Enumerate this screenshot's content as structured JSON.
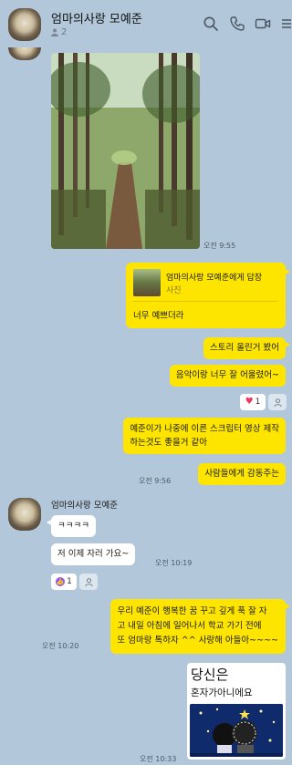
{
  "header": {
    "title": "엄마의사랑 모예준",
    "member_count": "2",
    "icons": [
      "search-icon",
      "phone-icon",
      "video-call-icon",
      "menu-icon"
    ]
  },
  "colors": {
    "background": "#b2c7da",
    "my_bubble": "#fee500",
    "other_bubble": "#ffffff",
    "heart": "#e83a5e"
  },
  "messages": {
    "photo_time": "오전 9:55",
    "reply": {
      "to": "엄마의사랑 모예준에게 답장",
      "type": "사진",
      "text": "너무 예쁘더라"
    },
    "m1": "스토리 올린거 봤어",
    "m2": "음악이랑 너무 잘 어울렸어~",
    "reaction1_count": "1",
    "m3_line1": "예준이가 나중에 이른 스크립터 영상 제작",
    "m3_line2": "하는것도 좋을거 같아",
    "m4": "사람들에게 감동주는",
    "m4_time": "오전 9:56",
    "sender": "엄마의사랑 모예준",
    "m5": "ㅋㅋㅋㅋ",
    "m6": "저 이제 자러 가요~",
    "m6_time": "오전 10:19",
    "reaction2_count": "1",
    "m7_line1": "우리 예준이 행복한 꿈 꾸고 깊게 푹 잘 자",
    "m7_line2": "고 내일 아침에 일어나서 학교 가기 전에",
    "m7_line3": "또 엄마랑 톡하자 ^^ 사랑해 아들아~~~~",
    "m7_time": "오전 10:20",
    "sticker_line1": "당신은",
    "sticker_line2": "혼자가아니에요",
    "sticker_time": "오전 10:33"
  }
}
